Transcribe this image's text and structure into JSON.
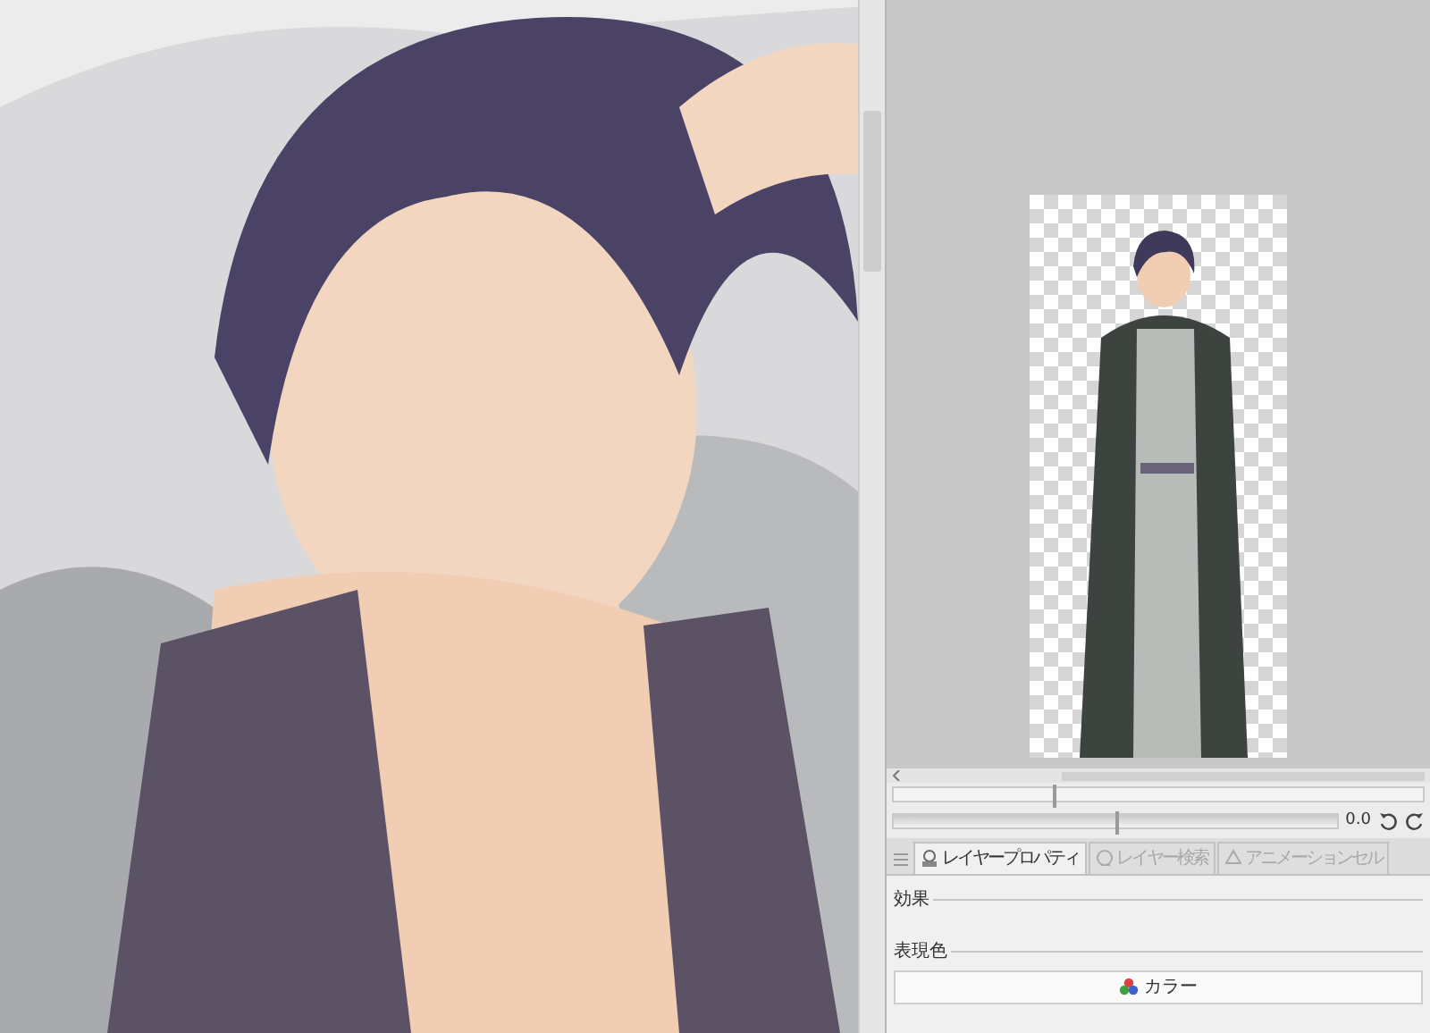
{
  "navigator": {
    "zoom_slider": {
      "level": 0.3
    },
    "rotate_slider": {
      "level": 0.5
    },
    "rotation": "0.0"
  },
  "panel_tabs": [
    {
      "label": "レイヤープロパティ",
      "selected": true
    },
    {
      "label": "レイヤー検索",
      "selected": false
    },
    {
      "label": "アニメーションセル",
      "selected": false
    }
  ],
  "sections": [
    {
      "title": "効果"
    },
    {
      "title": "表現色",
      "button": "カラー"
    }
  ]
}
